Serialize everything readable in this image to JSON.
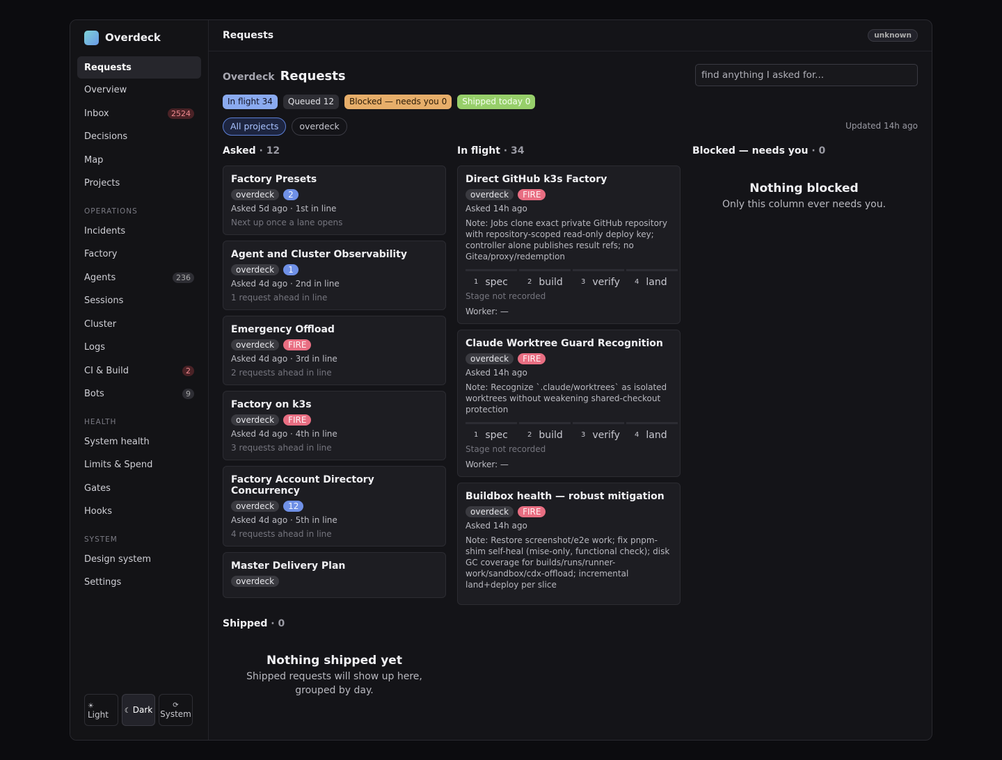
{
  "brand": {
    "name": "Overdeck"
  },
  "sidebar": {
    "primary": [
      {
        "label": "Requests",
        "badge": "",
        "active": true
      },
      {
        "label": "Overview",
        "badge": ""
      },
      {
        "label": "Inbox",
        "badge": "2524",
        "badge_type": "red"
      },
      {
        "label": "Decisions",
        "badge": ""
      },
      {
        "label": "Map",
        "badge": ""
      },
      {
        "label": "Projects",
        "badge": ""
      }
    ],
    "sections": [
      {
        "title": "OPERATIONS",
        "items": [
          {
            "label": "Incidents",
            "badge": ""
          },
          {
            "label": "Factory",
            "badge": ""
          },
          {
            "label": "Agents",
            "badge": "236",
            "badge_type": "gray"
          },
          {
            "label": "Sessions",
            "badge": ""
          },
          {
            "label": "Cluster",
            "badge": ""
          },
          {
            "label": "Logs",
            "badge": ""
          },
          {
            "label": "CI & Build",
            "badge": "2",
            "badge_type": "red"
          },
          {
            "label": "Bots",
            "badge": "9",
            "badge_type": "gray"
          }
        ]
      },
      {
        "title": "HEALTH",
        "items": [
          {
            "label": "System health",
            "badge": ""
          },
          {
            "label": "Limits & Spend",
            "badge": ""
          },
          {
            "label": "Gates",
            "badge": ""
          },
          {
            "label": "Hooks",
            "badge": ""
          }
        ]
      },
      {
        "title": "SYSTEM",
        "items": [
          {
            "label": "Design system",
            "badge": ""
          },
          {
            "label": "Settings",
            "badge": ""
          }
        ]
      }
    ],
    "theme": [
      {
        "icon": "☀",
        "label": "Light"
      },
      {
        "icon": "☾",
        "label": "Dark",
        "active": true
      },
      {
        "icon": "⟳",
        "label": "System"
      }
    ]
  },
  "topbar": {
    "title": "Requests",
    "status": "unknown"
  },
  "header": {
    "crumb": "Overdeck",
    "title": "Requests",
    "search_placeholder": "find anything I asked for...",
    "updated": "Updated 14h ago"
  },
  "summary": [
    {
      "label": "In flight 34",
      "style": "blue"
    },
    {
      "label": "Queued 12",
      "style": "gray"
    },
    {
      "label": "Blocked — needs you 0",
      "style": "orange"
    },
    {
      "label": "Shipped today 0",
      "style": "green"
    }
  ],
  "filters": [
    {
      "label": "All projects",
      "active": true
    },
    {
      "label": "overdeck"
    }
  ],
  "columns": {
    "asked": {
      "title": "Asked",
      "count": "· 12",
      "cards": [
        {
          "title": "Factory Presets",
          "project": "overdeck",
          "priority": "2",
          "meta": "Asked 5d ago · 1st in line",
          "sub": "Next up once a lane opens"
        },
        {
          "title": "Agent and Cluster Observability",
          "project": "overdeck",
          "priority": "1",
          "meta": "Asked 4d ago · 2nd in line",
          "sub": "1 request ahead in line"
        },
        {
          "title": "Emergency Offload",
          "project": "overdeck",
          "priority": "FIRE",
          "meta": "Asked 4d ago · 3rd in line",
          "sub": "2 requests ahead in line"
        },
        {
          "title": "Factory on k3s",
          "project": "overdeck",
          "priority": "FIRE",
          "meta": "Asked 4d ago · 4th in line",
          "sub": "3 requests ahead in line"
        },
        {
          "title": "Factory Account Directory Concurrency",
          "project": "overdeck",
          "priority": "12",
          "meta": "Asked 4d ago · 5th in line",
          "sub": "4 requests ahead in line"
        },
        {
          "title": "Master Delivery Plan",
          "project": "overdeck",
          "priority": "",
          "meta": "",
          "sub": ""
        }
      ]
    },
    "inflight": {
      "title": "In flight",
      "count": "· 34",
      "stages": [
        {
          "num": "1",
          "label": "spec"
        },
        {
          "num": "2",
          "label": "build"
        },
        {
          "num": "3",
          "label": "verify"
        },
        {
          "num": "4",
          "label": "land"
        }
      ],
      "cards": [
        {
          "title": "Direct GitHub k3s Factory",
          "project": "overdeck",
          "priority": "FIRE",
          "meta": "Asked 14h ago",
          "note": "Note: Jobs clone exact private GitHub repository with repository-scoped read-only deploy key; controller alone publishes result refs; no Gitea/proxy/redemption",
          "stage_status": "Stage not recorded",
          "worker": "Worker: —"
        },
        {
          "title": "Claude Worktree Guard Recognition",
          "project": "overdeck",
          "priority": "FIRE",
          "meta": "Asked 14h ago",
          "note": "Note: Recognize `.claude/worktrees` as isolated worktrees without weakening shared-checkout protection",
          "stage_status": "Stage not recorded",
          "worker": "Worker: —"
        },
        {
          "title": "Buildbox health — robust mitigation",
          "project": "overdeck",
          "priority": "FIRE",
          "meta": "Asked 14h ago",
          "note": "Note: Restore screenshot/e2e work; fix pnpm-shim self-heal (mise-only, functional check); disk GC coverage for builds/runs/runner-work/sandbox/cdx-offload; incremental land+deploy per slice",
          "stage_status": "",
          "worker": ""
        }
      ]
    },
    "blocked": {
      "title": "Blocked — needs you",
      "count": "· 0",
      "empty_title": "Nothing blocked",
      "empty_sub": "Only this column ever needs you."
    },
    "shipped": {
      "title": "Shipped",
      "count": "· 0",
      "empty_title": "Nothing shipped yet",
      "empty_sub": "Shipped requests will show up here, grouped by day."
    }
  }
}
